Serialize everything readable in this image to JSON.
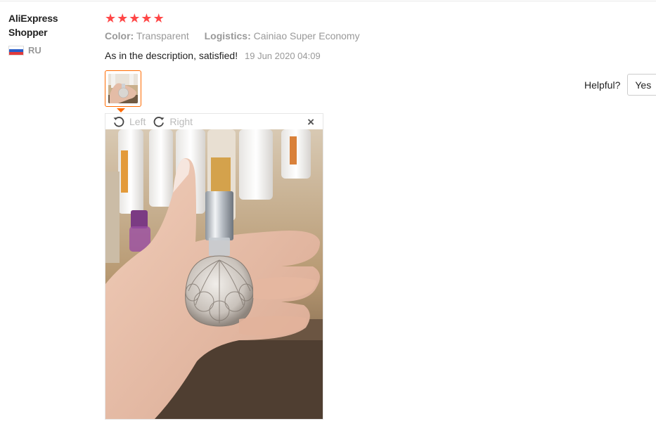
{
  "user": {
    "name_line1": "AliExpress",
    "name_line2": "Shopper",
    "country_code": "RU",
    "flag_icon": "russia-flag-icon",
    "flag_colors": [
      "#ffffff",
      "#2a5ec9",
      "#e23a3a"
    ]
  },
  "review": {
    "rating": 5,
    "star_glyph": "★",
    "star_color": "#ff4747",
    "color_label": "Color:",
    "color_value": "Transparent",
    "logistics_label": "Logistics:",
    "logistics_value": "Cainiao Super Economy",
    "text": "As in the description, satisfied!",
    "date": "19 Jun 2020 04:09"
  },
  "viewer": {
    "rotate_left_label": "Left",
    "rotate_right_label": "Right",
    "close_glyph": "×",
    "photo_description_icon": "photo-perfume-bottle"
  },
  "helpful": {
    "label": "Helpful?",
    "yes_label": "Yes"
  },
  "colors": {
    "accent": "#ff6a00",
    "muted_text": "#999999"
  }
}
